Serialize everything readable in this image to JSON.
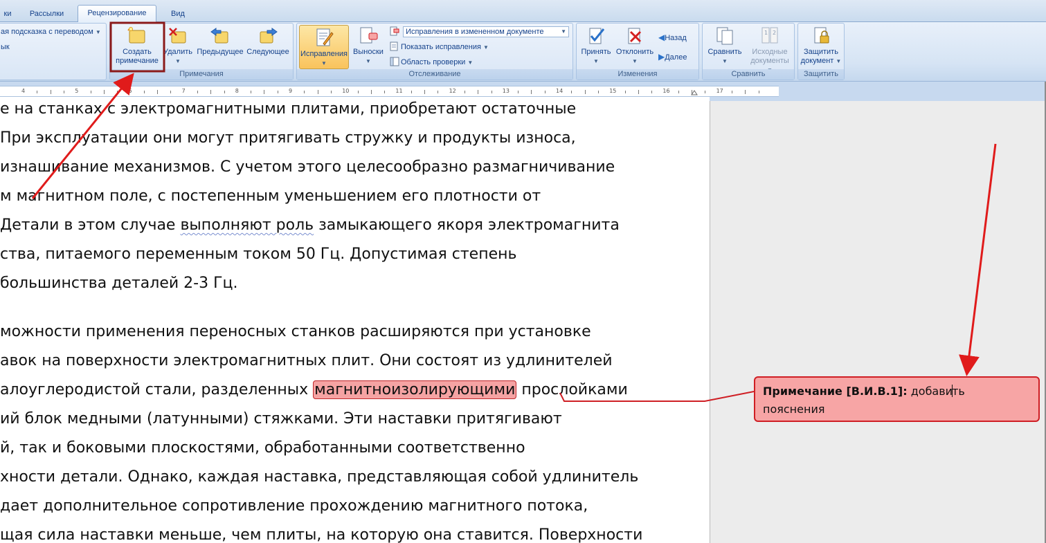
{
  "tabs": [
    "ки",
    "Рассылки",
    "Рецензирование",
    "Вид"
  ],
  "ribbon": {
    "left_partial": {
      "line1": "ая подсказка с переводом",
      "line2": "ык"
    },
    "comments_group": {
      "label": "Примечания",
      "create_line1": "Создать",
      "create_line2": "примечание",
      "delete": "Удалить",
      "previous": "Предыдущее",
      "next": "Следующее"
    },
    "tracking_group": {
      "label": "Отслеживание",
      "track_changes": "Исправления",
      "balloons": "Выноски",
      "display_mode": "Исправления в измененном документе",
      "show_markup": "Показать исправления",
      "reviewing_pane": "Область проверки"
    },
    "changes_group": {
      "label": "Изменения",
      "accept": "Принять",
      "reject": "Отклонить",
      "back": "Назад",
      "forward": "Далее"
    },
    "compare_group": {
      "label": "Сравнить",
      "compare": "Сравнить",
      "source_line1": "Исходные",
      "source_line2": "документы"
    },
    "protect_group": {
      "label": "Защитить",
      "protect_line1": "Защитить",
      "protect_line2": "документ"
    }
  },
  "ruler": {
    "numbers": [
      "4",
      "5",
      "6",
      "7",
      "8",
      "9",
      "10",
      "11",
      "12",
      "13",
      "14",
      "15",
      "16",
      "17"
    ]
  },
  "document": {
    "lines": [
      "е на станках с электромагнитными плитами, приобретают остаточные",
      "При эксплуатации они могут притягивать стружку и продукты износа,",
      "изнашивание механизмов. С учетом этого целесообразно размагничивание",
      "м магнитном поле, с постепенным уменьшением его плотности от",
      "Детали в этом случае ",
      "ства, питаемого переменным током 50 Гц. Допустимая степень",
      "большинства деталей 2-3 Гц.",
      "можности применения переносных станков расширяются при установке",
      "авок на поверхности электромагнитных плит. Они состоят из удлинителей",
      "алоуглеродистой стали, разделенных ",
      "ий блок медными (латунными) стяжками. Эти наставки притягивают",
      "й, так и боковыми плоскостями, обработанными соответственно",
      "хности детали. Однако, каждая наставка, представляющая собой удлинитель",
      "дает дополнительное сопротивление прохождению магнитного потока,",
      "щая сила наставки меньше, чем плиты, на которую она ставится. Поверхности"
    ],
    "line5_underlined": "выполняют роль",
    "line5_tail": " замыкающего якоря электромагнита",
    "line10_highlight": "магнитноизолирующими",
    "line10_tail": " прослойками"
  },
  "comment": {
    "author_label": "Примечание [В.И.В.1]:",
    "text_before_cursor": " добави",
    "text_after_cursor": "ть",
    "text_line2": "пояснения"
  },
  "colors": {
    "annotation_red": "#e01b1b",
    "highlight": "#f5a3a3",
    "comment_border": "#cf1e24"
  }
}
